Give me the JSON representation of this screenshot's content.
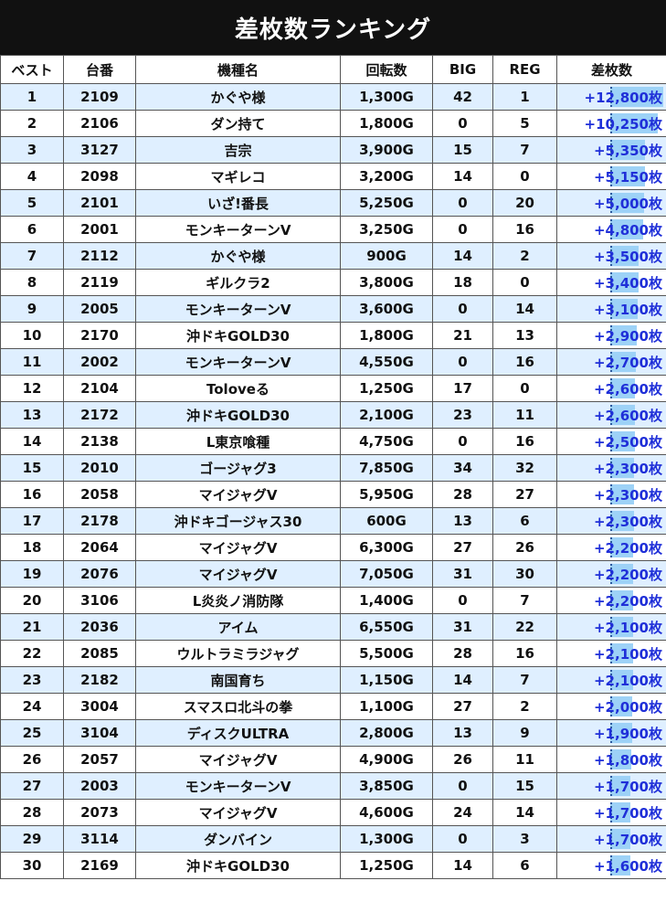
{
  "title": "差枚数ランキング",
  "headers": [
    "ベスト",
    "台番",
    "機種名",
    "回転数",
    "BIG",
    "REG",
    "差枚数"
  ],
  "rows": [
    {
      "rank": "1",
      "machine_no": "2109",
      "model": "かぐや様",
      "spins": "1,300G",
      "big": "42",
      "reg": "1",
      "diff": "+12,800枚",
      "diff_value": 12800
    },
    {
      "rank": "2",
      "machine_no": "2106",
      "model": "ダン持て",
      "spins": "1,800G",
      "big": "0",
      "reg": "5",
      "diff": "+10,250枚",
      "diff_value": 10250
    },
    {
      "rank": "3",
      "machine_no": "3127",
      "model": "吉宗",
      "spins": "3,900G",
      "big": "15",
      "reg": "7",
      "diff": "+5,350枚",
      "diff_value": 5350
    },
    {
      "rank": "4",
      "machine_no": "2098",
      "model": "マギレコ",
      "spins": "3,200G",
      "big": "14",
      "reg": "0",
      "diff": "+5,150枚",
      "diff_value": 5150
    },
    {
      "rank": "5",
      "machine_no": "2101",
      "model": "いざ!番長",
      "spins": "5,250G",
      "big": "0",
      "reg": "20",
      "diff": "+5,000枚",
      "diff_value": 5000
    },
    {
      "rank": "6",
      "machine_no": "2001",
      "model": "モンキーターンV",
      "spins": "3,250G",
      "big": "0",
      "reg": "16",
      "diff": "+4,800枚",
      "diff_value": 4800
    },
    {
      "rank": "7",
      "machine_no": "2112",
      "model": "かぐや様",
      "spins": "900G",
      "big": "14",
      "reg": "2",
      "diff": "+3,500枚",
      "diff_value": 3500
    },
    {
      "rank": "8",
      "machine_no": "2119",
      "model": "ギルクラ2",
      "spins": "3,800G",
      "big": "18",
      "reg": "0",
      "diff": "+3,400枚",
      "diff_value": 3400
    },
    {
      "rank": "9",
      "machine_no": "2005",
      "model": "モンキーターンV",
      "spins": "3,600G",
      "big": "0",
      "reg": "14",
      "diff": "+3,100枚",
      "diff_value": 3100
    },
    {
      "rank": "10",
      "machine_no": "2170",
      "model": "沖ドキGOLD30",
      "spins": "1,800G",
      "big": "21",
      "reg": "13",
      "diff": "+2,900枚",
      "diff_value": 2900
    },
    {
      "rank": "11",
      "machine_no": "2002",
      "model": "モンキーターンV",
      "spins": "4,550G",
      "big": "0",
      "reg": "16",
      "diff": "+2,700枚",
      "diff_value": 2700
    },
    {
      "rank": "12",
      "machine_no": "2104",
      "model": "Toloveる",
      "spins": "1,250G",
      "big": "17",
      "reg": "0",
      "diff": "+2,600枚",
      "diff_value": 2600
    },
    {
      "rank": "13",
      "machine_no": "2172",
      "model": "沖ドキGOLD30",
      "spins": "2,100G",
      "big": "23",
      "reg": "11",
      "diff": "+2,600枚",
      "diff_value": 2600
    },
    {
      "rank": "14",
      "machine_no": "2138",
      "model": "L東京喰種",
      "spins": "4,750G",
      "big": "0",
      "reg": "16",
      "diff": "+2,500枚",
      "diff_value": 2500
    },
    {
      "rank": "15",
      "machine_no": "2010",
      "model": "ゴージャグ3",
      "spins": "7,850G",
      "big": "34",
      "reg": "32",
      "diff": "+2,300枚",
      "diff_value": 2300
    },
    {
      "rank": "16",
      "machine_no": "2058",
      "model": "マイジャグV",
      "spins": "5,950G",
      "big": "28",
      "reg": "27",
      "diff": "+2,300枚",
      "diff_value": 2300
    },
    {
      "rank": "17",
      "machine_no": "2178",
      "model": "沖ドキゴージャス30",
      "spins": "600G",
      "big": "13",
      "reg": "6",
      "diff": "+2,300枚",
      "diff_value": 2300
    },
    {
      "rank": "18",
      "machine_no": "2064",
      "model": "マイジャグV",
      "spins": "6,300G",
      "big": "27",
      "reg": "26",
      "diff": "+2,200枚",
      "diff_value": 2200
    },
    {
      "rank": "19",
      "machine_no": "2076",
      "model": "マイジャグV",
      "spins": "7,050G",
      "big": "31",
      "reg": "30",
      "diff": "+2,200枚",
      "diff_value": 2200
    },
    {
      "rank": "20",
      "machine_no": "3106",
      "model": "L炎炎ノ消防隊",
      "spins": "1,400G",
      "big": "0",
      "reg": "7",
      "diff": "+2,200枚",
      "diff_value": 2200
    },
    {
      "rank": "21",
      "machine_no": "2036",
      "model": "アイム",
      "spins": "6,550G",
      "big": "31",
      "reg": "22",
      "diff": "+2,100枚",
      "diff_value": 2100
    },
    {
      "rank": "22",
      "machine_no": "2085",
      "model": "ウルトラミラジャグ",
      "spins": "5,500G",
      "big": "28",
      "reg": "16",
      "diff": "+2,100枚",
      "diff_value": 2100
    },
    {
      "rank": "23",
      "machine_no": "2182",
      "model": "南国育ち",
      "spins": "1,150G",
      "big": "14",
      "reg": "7",
      "diff": "+2,100枚",
      "diff_value": 2100
    },
    {
      "rank": "24",
      "machine_no": "3004",
      "model": "スマスロ北斗の拳",
      "spins": "1,100G",
      "big": "27",
      "reg": "2",
      "diff": "+2,000枚",
      "diff_value": 2000
    },
    {
      "rank": "25",
      "machine_no": "3104",
      "model": "ディスクULTRA",
      "spins": "2,800G",
      "big": "13",
      "reg": "9",
      "diff": "+1,900枚",
      "diff_value": 1900
    },
    {
      "rank": "26",
      "machine_no": "2057",
      "model": "マイジャグV",
      "spins": "4,900G",
      "big": "26",
      "reg": "11",
      "diff": "+1,800枚",
      "diff_value": 1800
    },
    {
      "rank": "27",
      "machine_no": "2003",
      "model": "モンキーターンV",
      "spins": "3,850G",
      "big": "0",
      "reg": "15",
      "diff": "+1,700枚",
      "diff_value": 1700
    },
    {
      "rank": "28",
      "machine_no": "2073",
      "model": "マイジャグV",
      "spins": "4,600G",
      "big": "24",
      "reg": "14",
      "diff": "+1,700枚",
      "diff_value": 1700
    },
    {
      "rank": "29",
      "machine_no": "3114",
      "model": "ダンバイン",
      "spins": "1,300G",
      "big": "0",
      "reg": "3",
      "diff": "+1,700枚",
      "diff_value": 1700
    },
    {
      "rank": "30",
      "machine_no": "2169",
      "model": "沖ドキGOLD30",
      "spins": "1,250G",
      "big": "14",
      "reg": "6",
      "diff": "+1,600枚",
      "diff_value": 1600
    }
  ],
  "colors": {
    "title_bg": "#111111",
    "row_alt_bg": "#dfefff",
    "diff_text": "#1f2fd8",
    "diff_bar": "#9dd2f7"
  }
}
